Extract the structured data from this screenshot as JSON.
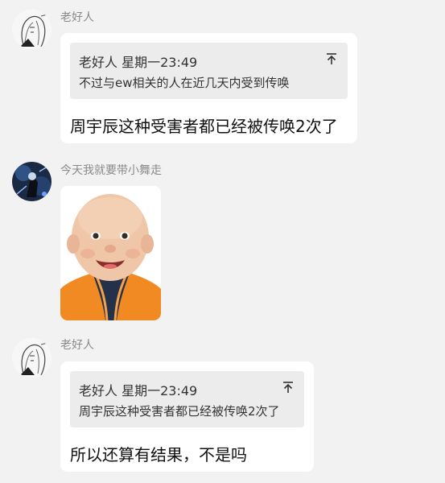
{
  "messages": [
    {
      "sender": "老好人",
      "quote": {
        "header": "老好人 星期一23:49",
        "text": "不过与ew相关的人在近几天内受到传唤"
      },
      "text": "周宇辰这种受害者都已经被传唤2次了",
      "avatar_icon": "sketch-girl-avatar"
    },
    {
      "sender": "今天我就要带小舞走",
      "image": "baby-photo",
      "avatar_icon": "dark-character-avatar"
    },
    {
      "sender": "老好人",
      "quote": {
        "header": "老好人 星期一23:49",
        "text": "周宇辰这种受害者都已经被传唤2次了"
      },
      "text": "所以还算有结果，不是吗",
      "avatar_icon": "sketch-girl-avatar"
    }
  ],
  "colors": {
    "background": "#f2f2f2",
    "bubble": "#ffffff",
    "quote": "#ececec",
    "sender": "#8a8a8a"
  }
}
